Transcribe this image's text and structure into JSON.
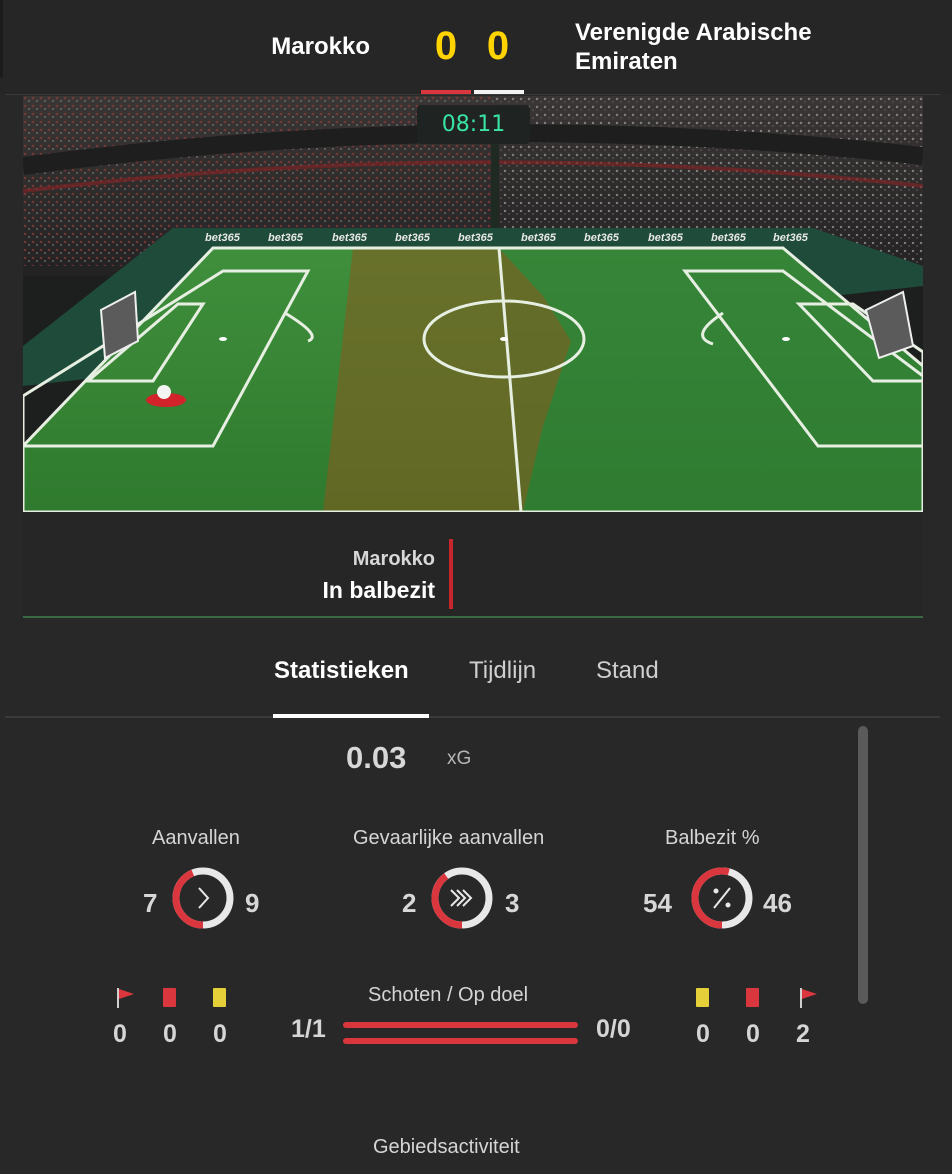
{
  "header": {
    "home_team": "Marokko",
    "away_team": "Verenigde Arabische Emiraten",
    "home_score": "0",
    "away_score": "0",
    "home_color": "#d9363e",
    "away_color": "#f2f2f2",
    "score_color": "#ffd400"
  },
  "match": {
    "clock": "08:11",
    "board_text": "bet365"
  },
  "possession": {
    "team": "Marokko",
    "state": "In balbezit"
  },
  "tabs": [
    {
      "label": "Statistieken",
      "active": true
    },
    {
      "label": "Tijdlijn",
      "active": false
    },
    {
      "label": "Stand",
      "active": false
    }
  ],
  "stats": {
    "xg": {
      "value": "0.03",
      "label": "xG"
    },
    "attacks": {
      "title": "Aanvallen",
      "home": "7",
      "away": "9",
      "icon": "chevron-right-icon"
    },
    "dangerous_attacks": {
      "title": "Gevaarlijke aanvallen",
      "home": "2",
      "away": "3",
      "icon": "triple-chevron-icon"
    },
    "possession_pct": {
      "title": "Balbezit %",
      "home": "54",
      "away": "46",
      "icon": "percent-icon"
    },
    "home_discipline": {
      "corners": "0",
      "red_cards": "0",
      "yellow_cards": "0"
    },
    "away_discipline": {
      "yellow_cards": "0",
      "red_cards": "0",
      "corners": "2"
    },
    "shots": {
      "title": "Schoten / Op doel",
      "home": "1/1",
      "away": "0/0"
    },
    "area_activity": {
      "title": "Gebiedsactiviteit"
    }
  }
}
